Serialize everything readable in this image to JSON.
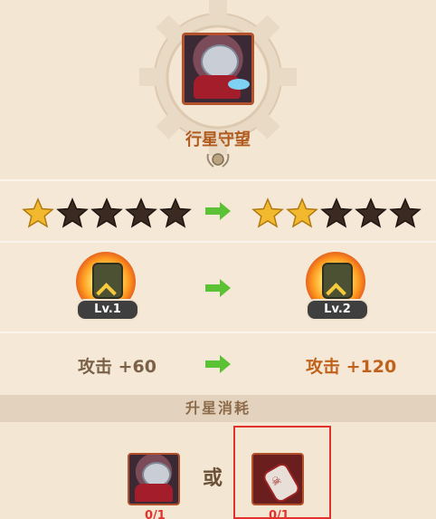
{
  "skill": {
    "name": "行星守望"
  },
  "star_upgrade": {
    "before_filled": 1,
    "after_filled": 2,
    "total": 5,
    "filled_color": "#f2b92e",
    "empty_color": "#3a2a22",
    "arrow_color": "#5bc236"
  },
  "level_upgrade": {
    "before_label": "Lv.1",
    "after_label": "Lv.2"
  },
  "attack_upgrade": {
    "before": "攻击 +60",
    "after": "攻击 +120",
    "before_color": "#7a6148",
    "after_color": "#c0621b"
  },
  "cost": {
    "title": "升星消耗",
    "or_label": "或",
    "item1_count": "0/1",
    "item2_count": "0/1",
    "highlight_color": "#e3312b"
  }
}
